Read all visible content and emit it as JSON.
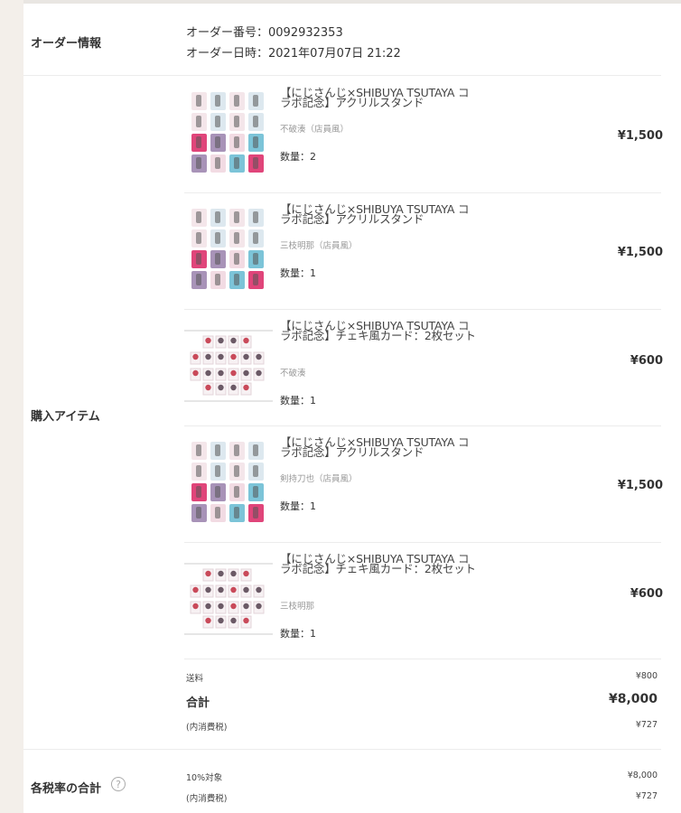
{
  "order_info": {
    "label": "オーダー情報",
    "number_line": "オーダー番号：0092932353",
    "date_line": "オーダー日時：2021年07月07日 21:22"
  },
  "purchased_items_label": "購入アイテム",
  "items": [
    {
      "title": "【にじさんじ×SHIBUYA TSUTAYA コラボ記念】アクリルスタンド",
      "variant": "不破湊（店員風）",
      "qty": "数量：2",
      "price": "¥1,500",
      "thumb": "acrylic-stand"
    },
    {
      "title": "【にじさんじ×SHIBUYA TSUTAYA コラボ記念】アクリルスタンド",
      "variant": "三枝明那（店員風）",
      "qty": "数量：1",
      "price": "¥1,500",
      "thumb": "acrylic-stand"
    },
    {
      "title": "【にじさんじ×SHIBUYA TSUTAYA コラボ記念】チェキ風カード：2枚セット",
      "variant": "不破湊",
      "qty": "数量：1",
      "price": "¥600",
      "thumb": "cheki-card"
    },
    {
      "title": "【にじさんじ×SHIBUYA TSUTAYA コラボ記念】アクリルスタンド",
      "variant": "剣持刀也（店員風）",
      "qty": "数量：1",
      "price": "¥1,500",
      "thumb": "acrylic-stand"
    },
    {
      "title": "【にじさんじ×SHIBUYA TSUTAYA コラボ記念】チェキ風カード：2枚セット",
      "variant": "三枝明那",
      "qty": "数量：1",
      "price": "¥600",
      "thumb": "cheki-card"
    }
  ],
  "summary": {
    "shipping_label": "送料",
    "shipping_value": "¥800",
    "total_label": "合計",
    "total_value": "¥8,000",
    "tax_label": "(内消費税)",
    "tax_value": "¥727"
  },
  "tax_rate": {
    "label": "各税率の合計",
    "help_icon": "?",
    "rate_label": "10%対象",
    "rate_value": "¥8,000",
    "tax_label": "(内消費税)",
    "tax_value": "¥727"
  },
  "colors": {
    "card_pink": "#e0457a",
    "card_blue": "#7cc4d8",
    "card_lav": "#a893b8",
    "card_light": "#f2dbe3"
  }
}
